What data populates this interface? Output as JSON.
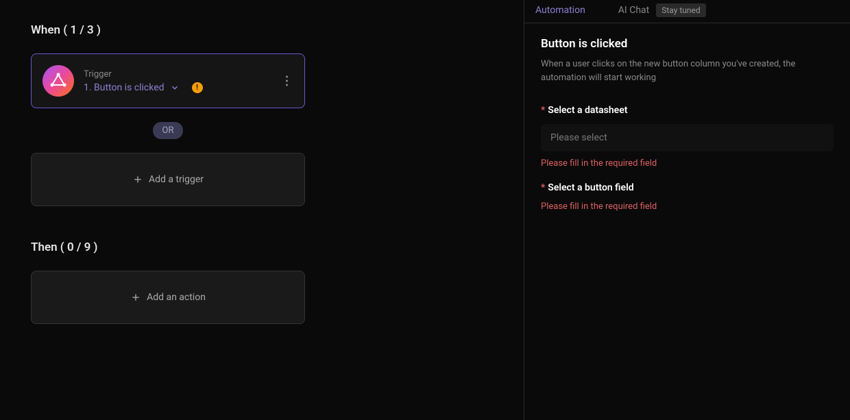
{
  "leftPanel": {
    "whenTitle": "When ( 1 / 3 )",
    "trigger": {
      "label": "Trigger",
      "action": "1. Button is clicked"
    },
    "orLabel": "OR",
    "addTrigger": "Add a trigger",
    "thenTitle": "Then ( 0 / 9 )",
    "addAction": "Add an action"
  },
  "rightPanel": {
    "tabs": {
      "automation": "Automation",
      "aiChat": "AI Chat",
      "stayTuned": "Stay tuned"
    },
    "detail": {
      "title": "Button is clicked",
      "description": "When a user clicks on the new button column you've created, the automation will start working"
    },
    "fields": {
      "datasheet": {
        "label": "Select a datasheet",
        "placeholder": "Please select",
        "error": "Please fill in the required field"
      },
      "buttonField": {
        "label": "Select a button field",
        "error": "Please fill in the required field"
      }
    }
  }
}
